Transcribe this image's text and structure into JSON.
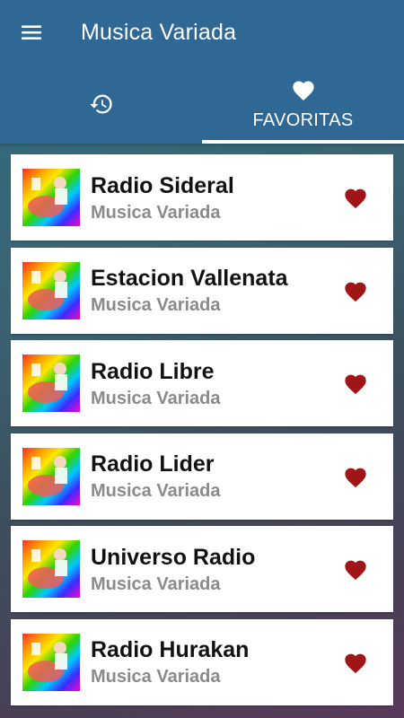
{
  "appbar": {
    "title": "Musica Variada",
    "menu_icon": "menu-icon"
  },
  "tabs": [
    {
      "label": "",
      "icon": "history-icon",
      "active": false
    },
    {
      "label": "FAVORITAS",
      "icon": "heart-icon",
      "active": true
    }
  ],
  "stations": [
    {
      "name": "Radio Sideral",
      "genre": "Musica Variada"
    },
    {
      "name": "Estacion Vallenata",
      "genre": "Musica Variada"
    },
    {
      "name": "Radio Libre",
      "genre": "Musica Variada"
    },
    {
      "name": "Radio Lider",
      "genre": "Musica Variada"
    },
    {
      "name": "Universo Radio",
      "genre": "Musica Variada"
    },
    {
      "name": "Radio Hurakan",
      "genre": "Musica Variada"
    }
  ],
  "colors": {
    "primary": "#2f6795",
    "favorite_heart": "#a01515",
    "subtitle": "#8a8a8a"
  }
}
